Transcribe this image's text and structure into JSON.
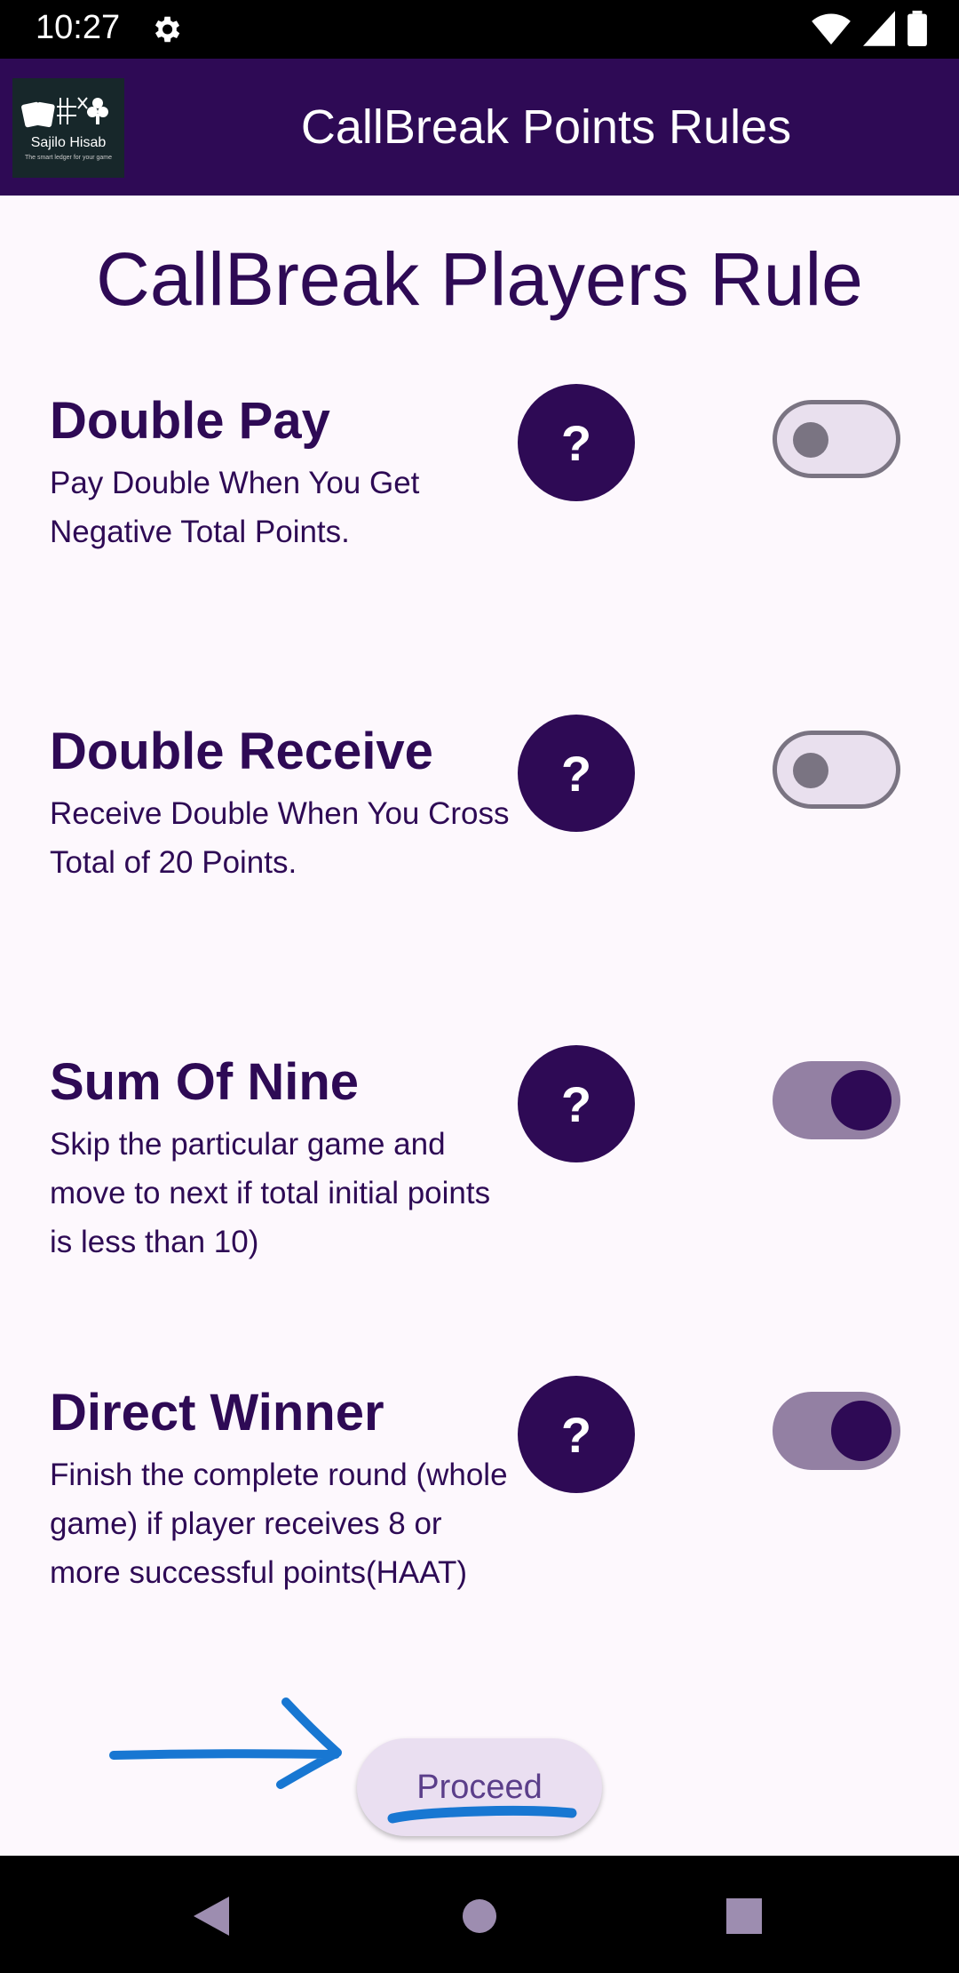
{
  "status_bar": {
    "time": "10:27",
    "icons": [
      "settings-icon",
      "wifi-icon",
      "cellular-signal-icon",
      "battery-icon"
    ]
  },
  "app_bar": {
    "logo": {
      "name": "Sajilo Hisab",
      "tagline": "The smart ledger for your game"
    },
    "title": "CallBreak Points Rules"
  },
  "main": {
    "page_title": "CallBreak Players Rule",
    "rules": [
      {
        "title": "Double Pay",
        "description": "Pay Double When You Get Negative Total Points.",
        "help_label": "?",
        "enabled": false
      },
      {
        "title": "Double Receive",
        "description": "Receive Double When You Cross Total of 20 Points.",
        "help_label": "?",
        "enabled": false
      },
      {
        "title": "Sum Of Nine",
        "description": "Skip the particular game and move to next if total initial points is less than 10)",
        "help_label": "?",
        "enabled": true
      },
      {
        "title": "Direct Winner",
        "description": "Finish the complete round (whole game) if player receives 8 or more successful points(HAAT)",
        "help_label": "?",
        "enabled": true
      }
    ],
    "proceed_label": "Proceed"
  },
  "nav_bar": {
    "icons": [
      "back-icon",
      "home-icon",
      "recents-icon"
    ]
  },
  "colors": {
    "primary": "#2e0a55",
    "toggle_on_track": "#9380a3",
    "toggle_off_track": "#e9e0ee",
    "annotation": "#1877d2",
    "background": "#fdf8fd"
  }
}
